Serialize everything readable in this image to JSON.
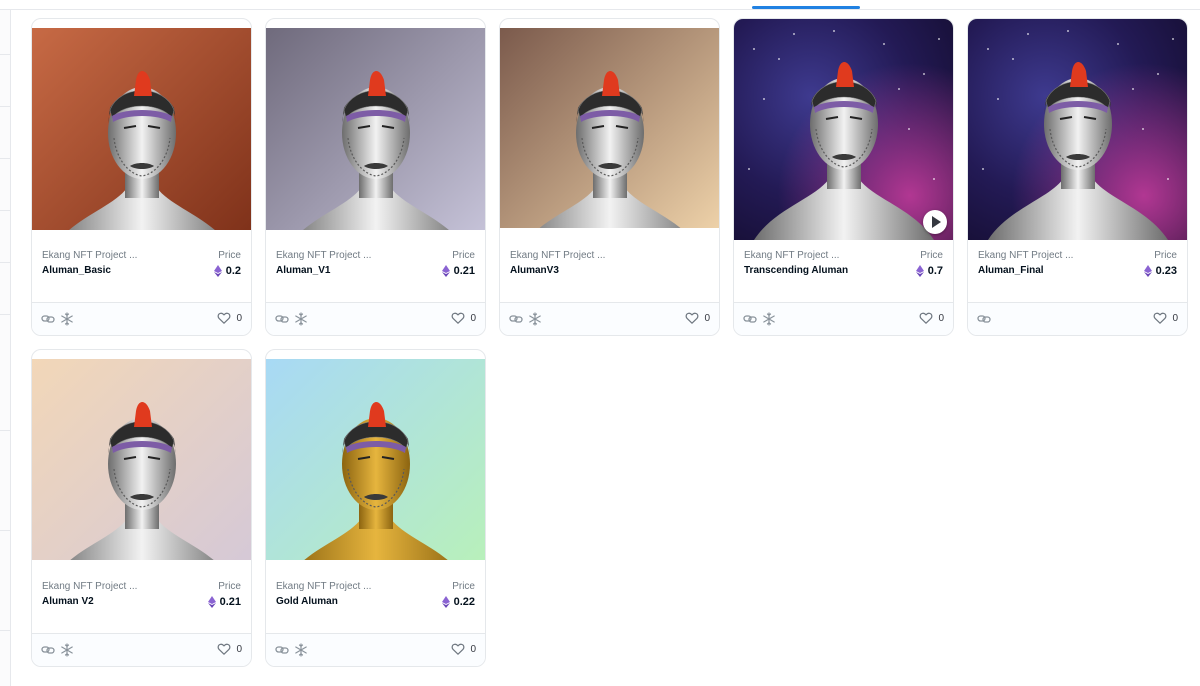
{
  "icons": {
    "eth": "ethereum-icon",
    "link": "link-chain-icon",
    "frozen": "snowflake-icon",
    "favorite": "heart-icon",
    "play": "play-icon"
  },
  "price_label": "Price",
  "cards": [
    {
      "collection": "Ekang NFT Project ...",
      "name": "Aluman_Basic",
      "price": "0.2",
      "favorites": "0",
      "background": "brown-gradient",
      "skin": "silver",
      "video": false,
      "frozen": true
    },
    {
      "collection": "Ekang NFT Project ...",
      "name": "Aluman_V1",
      "price": "0.21",
      "favorites": "0",
      "background": "gray-lavender-gradient",
      "skin": "silver",
      "video": false,
      "frozen": true
    },
    {
      "collection": "Ekang NFT Project ...",
      "name": "AlumanV3",
      "price": "",
      "favorites": "0",
      "background": "mocha-peach-gradient",
      "skin": "silver",
      "video": false,
      "frozen": true
    },
    {
      "collection": "Ekang NFT Project ...",
      "name": "Transcending Aluman",
      "price": "0.7",
      "favorites": "0",
      "background": "purple-space",
      "skin": "silver",
      "video": true,
      "frozen": true
    },
    {
      "collection": "Ekang NFT Project ...",
      "name": "Aluman_Final",
      "price": "0.23",
      "favorites": "0",
      "background": "purple-space",
      "skin": "silver",
      "video": false,
      "frozen": false
    },
    {
      "collection": "Ekang NFT Project ...",
      "name": "Aluman V2",
      "price": "0.21",
      "favorites": "0",
      "background": "peach-lavender-gradient",
      "skin": "silver",
      "video": false,
      "frozen": true
    },
    {
      "collection": "Ekang NFT Project ...",
      "name": "Gold Aluman",
      "price": "0.22",
      "favorites": "0",
      "background": "sky-mint-gradient",
      "skin": "gold",
      "video": false,
      "frozen": true
    }
  ]
}
